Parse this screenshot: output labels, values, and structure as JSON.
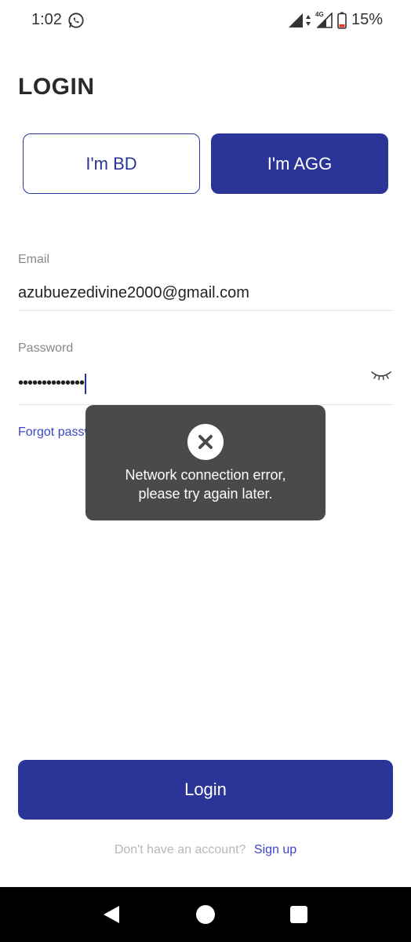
{
  "status_bar": {
    "time": "1:02",
    "network": "4G",
    "battery": "15%",
    "icons": [
      "whatsapp-icon",
      "signal-icon",
      "data-arrows-icon",
      "signal-icon",
      "battery-icon"
    ]
  },
  "page": {
    "title": "LOGIN"
  },
  "roles": {
    "bd_label": "I'm BD",
    "agg_label": "I'm AGG",
    "selected": "I'm AGG"
  },
  "form": {
    "email_label": "Email",
    "email_value": "azubuezedivine2000@gmail.com",
    "password_label": "Password",
    "password_masked": "••••••••••••••",
    "forgot_label": "Forgot password?"
  },
  "toast": {
    "icon": "close-icon",
    "message_line1": "Network connection error,",
    "message_line2": "please try again later."
  },
  "actions": {
    "login_label": "Login",
    "signup_prompt": "Don't have an account?",
    "signup_label": "Sign up"
  },
  "colors": {
    "primary": "#2b3497",
    "link": "#3b45c4",
    "toast_bg": "#4a4a4a"
  },
  "nav_bar": {
    "icons": [
      "back-icon",
      "home-icon",
      "recents-icon"
    ]
  }
}
